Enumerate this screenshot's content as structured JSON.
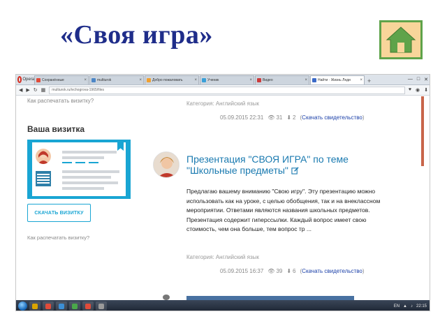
{
  "slide": {
    "title": "«Своя игра»",
    "home_button_icon": "home-icon",
    "colors": {
      "title": "#1f2d8a",
      "home_fill": "#f8d59a",
      "home_border": "#5fa34a"
    }
  },
  "browser": {
    "menu_label": "Opera",
    "tabs": [
      {
        "label": "Сохранённые",
        "color": "#e04b3a"
      },
      {
        "label": "multiurok",
        "color": "#4d87c7"
      },
      {
        "label": "Добро пожаловать",
        "color": "#f0a030"
      },
      {
        "label": "Ученик",
        "color": "#3aa0d8"
      },
      {
        "label": "Видео",
        "color": "#cc3b3b"
      },
      {
        "label": "Найти · Жизнь Леди",
        "color": "#3b6ac8",
        "active": true
      }
    ],
    "address": "multiurok.ru/ivchogrova-1965/files",
    "window_controls": [
      "—",
      "□",
      "✕"
    ]
  },
  "page": {
    "top_cut_text": "Как распечатать визитку?",
    "top_category": "Категория: Английский язык",
    "top_meta": {
      "date": "05.09.2015 22:31",
      "views": "31",
      "downloads": "2",
      "cert_link": "Скачать свидетельство"
    },
    "card": {
      "heading": "Ваша визитка",
      "button": "СКАЧАТЬ ВИЗИТКУ",
      "print_link": "Как распечатать визитку?"
    },
    "post": {
      "title": "Презентация \"СВОЯ ИГРА\" по теме \"Школьные предметы\"",
      "body": "Предлагаю вашему вниманию \"Свою игру\". Эту презентацию можно использовать как на уроке, с целью обобщения, так и на внеклассном мероприятии. Ответами являются названия школьных предметов. Презентация содержит гиперссылки. Каждый вопрос имеет свою стоимость, чем она больше, тем вопрос тр ...",
      "category": "Категория: Английский язык",
      "date": "05.09.2015 16:37",
      "views": "39",
      "downloads": "6",
      "cert_link": "Скачать свидетельство"
    }
  },
  "taskbar": {
    "apps": [
      "#d9a400",
      "#e04b3a",
      "#3c8fd6",
      "#4aa84a",
      "#e04b3a",
      "#9a9a9a"
    ],
    "lang": "EN",
    "clock": "22:15"
  }
}
